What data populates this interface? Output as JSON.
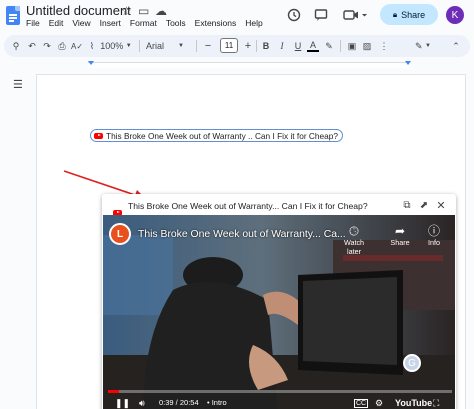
{
  "app": {
    "title": "Untitled document",
    "menu": [
      "File",
      "Edit",
      "View",
      "Insert",
      "Format",
      "Tools",
      "Extensions",
      "Help"
    ],
    "share_label": "Share",
    "avatar_initial": "K"
  },
  "toolbar": {
    "zoom": "100%",
    "font": "Arial",
    "font_size": "11"
  },
  "document": {
    "chip_text": "This Broke One Week out of Warranty .. Can I Fix it for Cheap?"
  },
  "preview": {
    "card_title": "This Broke One Week out of Warranty... Can I Fix it for Cheap?",
    "video_title": "This Broke One Week out of Warranty... Ca...",
    "channel_initial": "L",
    "actions": {
      "watch_later": "Watch later",
      "share": "Share",
      "info": "Info"
    },
    "time": "0:39 / 20:54",
    "chapter": "• Intro",
    "progress_fraction": 0.032,
    "youtube_label": "YouTube",
    "badge_initial": "G"
  },
  "colors": {
    "docs_blue": "#4285f4",
    "share_bg": "#c2e7ff",
    "avatar": "#6d2db8",
    "youtube_red": "#ff0000",
    "arrow_red": "#e02020"
  },
  "icons": [
    "docs-logo",
    "star-icon",
    "folder-move-icon",
    "cloud-saved-icon",
    "history-icon",
    "comment-icon",
    "meet-icon",
    "lock-icon",
    "undo-icon",
    "redo-icon",
    "print-icon",
    "spellcheck-icon",
    "paint-format-icon",
    "bold-icon",
    "italic-icon",
    "underline-icon",
    "text-color-icon",
    "highlight-icon",
    "insert-comment-icon",
    "insert-image-icon",
    "pencil-icon",
    "collapse-icon",
    "outline-icon",
    "copy-icon",
    "open-new-icon",
    "close-icon",
    "clock-icon",
    "share-arrow-icon",
    "info-icon",
    "play-icon",
    "volume-icon",
    "captions-icon",
    "settings-icon",
    "fullscreen-icon"
  ]
}
